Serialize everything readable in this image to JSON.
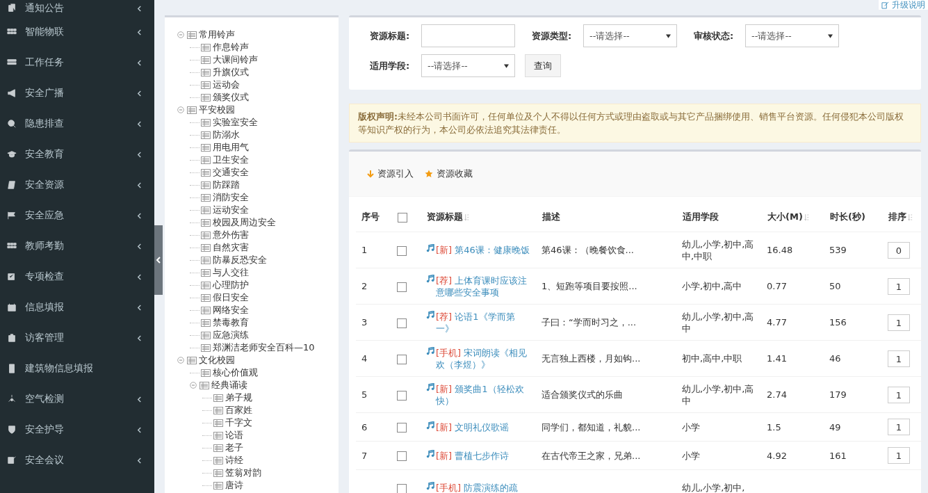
{
  "sidebar": {
    "items": [
      {
        "label": "通知公告",
        "expandable": true
      },
      {
        "label": "智能物联",
        "expandable": true
      },
      {
        "label": "工作任务",
        "expandable": true
      },
      {
        "label": "安全广播",
        "expandable": true
      },
      {
        "label": "隐患排查",
        "expandable": true
      },
      {
        "label": "安全教育",
        "expandable": true
      },
      {
        "label": "安全资源",
        "expandable": true
      },
      {
        "label": "安全应急",
        "expandable": true
      },
      {
        "label": "教师考勤",
        "expandable": true
      },
      {
        "label": "专项检查",
        "expandable": true
      },
      {
        "label": "信息填报",
        "expandable": true
      },
      {
        "label": "访客管理",
        "expandable": true
      },
      {
        "label": "建筑物信息填报",
        "expandable": false
      },
      {
        "label": "空气检测",
        "expandable": true
      },
      {
        "label": "安全护导",
        "expandable": true
      },
      {
        "label": "安全会议",
        "expandable": true
      }
    ]
  },
  "upgrade_link": "升级说明",
  "tree": [
    {
      "label": "常用铃声",
      "expanded": true,
      "children": [
        {
          "label": "作息铃声"
        },
        {
          "label": "大课间铃声"
        },
        {
          "label": "升旗仪式"
        },
        {
          "label": "运动会"
        },
        {
          "label": "颁奖仪式"
        }
      ]
    },
    {
      "label": "平安校园",
      "expanded": true,
      "children": [
        {
          "label": "实验室安全"
        },
        {
          "label": "防溺水"
        },
        {
          "label": "用电用气"
        },
        {
          "label": "卫生安全"
        },
        {
          "label": "交通安全"
        },
        {
          "label": "防踩踏"
        },
        {
          "label": "消防安全"
        },
        {
          "label": "运动安全"
        },
        {
          "label": "校园及周边安全"
        },
        {
          "label": "意外伤害"
        },
        {
          "label": "自然灾害"
        },
        {
          "label": "防暴反恐安全"
        },
        {
          "label": "与人交往"
        },
        {
          "label": "心理防护"
        },
        {
          "label": "假日安全"
        },
        {
          "label": "网络安全"
        },
        {
          "label": "禁毒教育"
        },
        {
          "label": "应急演练"
        },
        {
          "label": "郑渊洁老师安全百科—10"
        }
      ]
    },
    {
      "label": "文化校园",
      "expanded": true,
      "children": [
        {
          "label": "核心价值观"
        },
        {
          "label": "经典诵读",
          "expanded": true,
          "children": [
            {
              "label": "弟子规"
            },
            {
              "label": "百家姓"
            },
            {
              "label": "千字文"
            },
            {
              "label": "论语"
            },
            {
              "label": "老子"
            },
            {
              "label": "诗经"
            },
            {
              "label": "笠翁对韵"
            },
            {
              "label": "唐诗"
            }
          ]
        }
      ]
    }
  ],
  "filters": [
    {
      "kind": "text",
      "label": "资源标题:"
    },
    {
      "kind": "select",
      "label": "资源类型:",
      "placeholder": "--请选择--"
    },
    {
      "kind": "select",
      "label": "审核状态:",
      "placeholder": "--请选择--"
    },
    {
      "kind": "select",
      "label": "适用学段:",
      "placeholder": "--请选择--"
    }
  ],
  "search_button": "查询",
  "notice": {
    "title": "版权声明:",
    "text": "未经本公司书面许可，任何单位及个人不得以任何方式或理由盗取或与其它产品捆绑使用、销售平台资源。任何侵犯本公司版权等知识产权的行为，本公司必依法追究其法律责任。"
  },
  "toolbar": [
    {
      "kind": "import",
      "label": "资源引入"
    },
    {
      "kind": "favorite",
      "label": "资源收藏"
    }
  ],
  "table": {
    "columns": [
      {
        "label": "序号",
        "sortable": false
      },
      {
        "kind": "checkbox",
        "checked": false
      },
      {
        "label": "资源标题",
        "sortable": true
      },
      {
        "label": "描述",
        "sortable": false
      },
      {
        "label": "适用学段",
        "sortable": false
      },
      {
        "label": "大小(M)",
        "sortable": true
      },
      {
        "label": "时长(秒)",
        "sortable": false
      },
      {
        "label": "排序",
        "sortable": true
      }
    ],
    "rows": [
      {
        "no": "1",
        "checked": false,
        "tag": "[新]",
        "title": "第46课：健康晚饭",
        "description": "第46课：（晚餐饮食...",
        "stages": "幼儿,小学,初中,高中,中职",
        "size": "16.48",
        "duration": "539",
        "order": "0"
      },
      {
        "no": "2",
        "checked": false,
        "tag": "[荐]",
        "title": "上体育课时应该注意哪些安全事项",
        "description": "1、短跑等项目要按照...",
        "stages": "小学,初中,高中",
        "size": "0.77",
        "duration": "50",
        "order": "1"
      },
      {
        "no": "3",
        "checked": false,
        "tag": "[荐]",
        "title": "论语1《学而第一》",
        "description": "子曰：“学而时习之，...",
        "stages": "幼儿,小学,初中,高中",
        "size": "4.77",
        "duration": "156",
        "order": "1"
      },
      {
        "no": "4",
        "checked": false,
        "tag": "[手机]",
        "title": "宋词朗读《相见欢（李煜）》",
        "description": "无言独上西楼，月如钩...",
        "stages": "初中,高中,中职",
        "size": "1.41",
        "duration": "46",
        "order": "1"
      },
      {
        "no": "5",
        "checked": false,
        "tag": "[新]",
        "title": "颁奖曲1（轻松欢快）",
        "description": "适合颁奖仪式的乐曲",
        "stages": "幼儿,小学,初中,高中",
        "size": "2.74",
        "duration": "179",
        "order": "1"
      },
      {
        "no": "6",
        "checked": false,
        "tag": "[新]",
        "title": "文明礼仪歌谣",
        "description": "同学们，都知道，礼貌...",
        "stages": "小学",
        "size": "1.5",
        "duration": "49",
        "order": "1"
      },
      {
        "no": "7",
        "checked": false,
        "tag": "[新]",
        "title": "曹植七步作诗",
        "description": "在古代帝王之家，兄弟...",
        "stages": "小学",
        "size": "4.92",
        "duration": "161",
        "order": "1"
      },
      {
        "checked": false,
        "tag": "[手机]",
        "title": "防震演练的疏",
        "stages": "幼儿,小学,初中,"
      }
    ]
  }
}
